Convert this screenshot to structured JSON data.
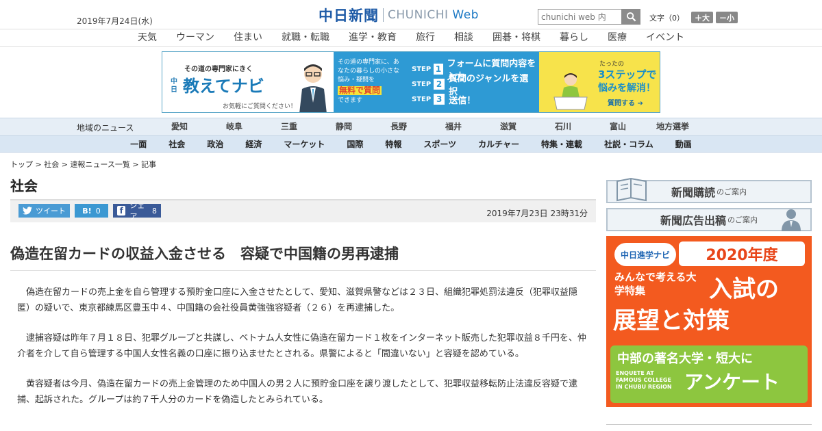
{
  "header": {
    "date": "2019年7月24日(水)",
    "logo_jp": "中日新聞",
    "logo_en_a": "CHUNICHI",
    "logo_en_b": "Web",
    "search_placeholder": "chunichi web 内",
    "fontsize_label": "文字（0）",
    "fontsize_up": "＋大",
    "fontsize_down": "－小"
  },
  "topics": [
    "天気",
    "ウーマン",
    "住まい",
    "就職・転職",
    "進学・教育",
    "旅行",
    "相談",
    "囲碁・将棋",
    "暮らし",
    "医療",
    "イベント"
  ],
  "banner": {
    "sub": "その道の専門家にきく",
    "small": "中日",
    "title": "教えてナビ",
    "foot": "お気軽にご質問ください！",
    "mid_text": "その道の専門家に、あなたの暮らしの小さな悩み・疑問を",
    "mid_free": "無料で質問",
    "mid_end": "できます",
    "steps": [
      {
        "label": "STEP",
        "num": "1",
        "text": "フォームに質問内容を入力"
      },
      {
        "label": "STEP",
        "num": "2",
        "text": "質問のジャンルを選択"
      },
      {
        "label": "STEP",
        "num": "3",
        "text": "送信！"
      }
    ],
    "r1": "たったの",
    "r2": "3ステップで",
    "r3": "悩みを解消！",
    "r4": "質問する"
  },
  "region": {
    "label": "地域のニュース",
    "items": [
      "愛知",
      "岐阜",
      "三重",
      "静岡",
      "長野",
      "福井",
      "滋賀",
      "石川",
      "富山",
      "地方選挙"
    ]
  },
  "categories": [
    "一面",
    "社会",
    "政治",
    "経済",
    "マーケット",
    "国際",
    "特報",
    "スポーツ",
    "カルチャー",
    "特集・連載",
    "社説・コラム",
    "動画"
  ],
  "article": {
    "breadcrumb": "トップ > 社会 > 速報ニュース一覧 > 記事",
    "section": "社会",
    "tweet": "ツイート",
    "hatena": "B!",
    "hatena_count": "0",
    "share": "シェア",
    "share_count": "8",
    "posted": "2019年7月23日 23時31分",
    "headline": "偽造在留カードの収益入金させる　容疑で中国籍の男再逮捕",
    "paragraphs": [
      "偽造在留カードの売上金を自ら管理する預貯金口座に入金させたとして、愛知、滋賀県警などは２３日、組織犯罪処罰法違反（犯罪収益隠匿）の疑いで、東京都練馬区豊玉中４、中国籍の会社役員黄強強容疑者（２６）を再逮捕した。",
      "逮捕容疑は昨年７月１８日、犯罪グループと共謀し、ベトナム人女性に偽造在留カード１枚をインターネット販売した犯罪収益８千円を、仲介者を介して自ら管理する中国人女性名義の口座に振り込ませたとされる。県警によると「間違いない」と容疑を認めている。",
      "黄容疑者は今月、偽造在留カードの売上金管理のため中国人の男２人に預貯金口座を譲り渡したとして、犯罪収益移転防止法違反容疑で逮捕、起訴された。グループは約７千人分のカードを偽造したとみられている。"
    ]
  },
  "sidebar": {
    "subscribe": "新聞購読",
    "subscribe_small": "のご案内",
    "ad_info": "新聞広告出稿",
    "ad_info_small": "のご案内",
    "ad": {
      "logo": "中日進学ナビ",
      "year": "2020年度",
      "t1": "みんなで考える大学特集",
      "t2": "入試の",
      "t3": "展望と対策",
      "g1": "中部の著名大学・短大に",
      "g2": "ENQUETE AT FAMOUS COLLEGE IN CHUBU REGION",
      "g3": "アンケート"
    }
  }
}
